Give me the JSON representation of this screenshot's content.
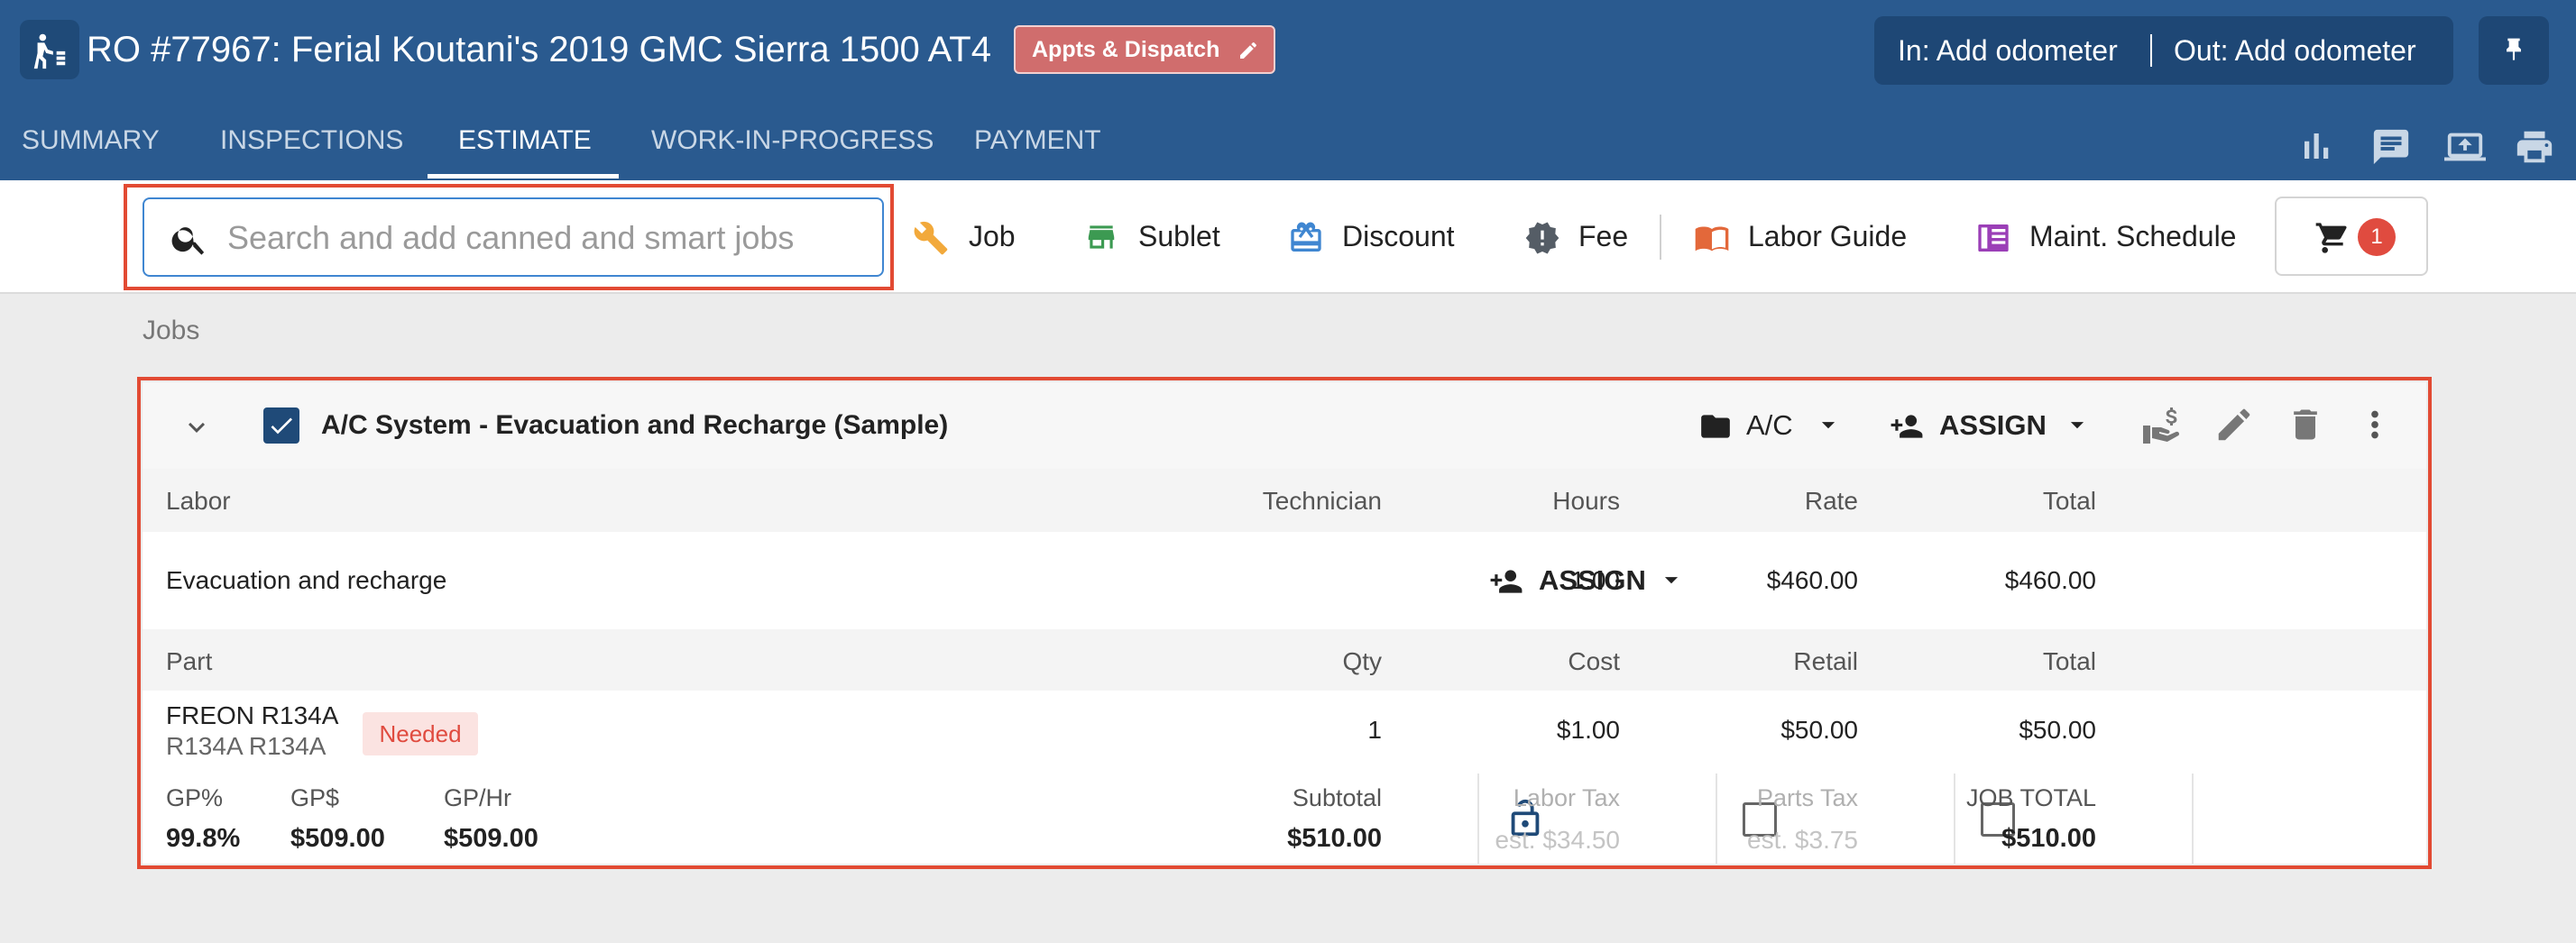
{
  "header": {
    "title": "RO #77967: Ferial Koutani's 2019 GMC Sierra 1500 AT4",
    "appts_label": "Appts & Dispatch",
    "odometer_in": "In: Add odometer",
    "odometer_out": "Out: Add odometer"
  },
  "tabs": [
    {
      "label": "SUMMARY",
      "active": false
    },
    {
      "label": "INSPECTIONS",
      "active": false
    },
    {
      "label": "ESTIMATE",
      "active": true
    },
    {
      "label": "WORK-IN-PROGRESS",
      "active": false
    },
    {
      "label": "PAYMENT",
      "active": false
    }
  ],
  "toolbar": {
    "search_placeholder": "Search and add canned and smart jobs",
    "job": "Job",
    "sublet": "Sublet",
    "discount": "Discount",
    "fee": "Fee",
    "labor_guide": "Labor Guide",
    "maint_schedule": "Maint. Schedule",
    "cart_count": "1"
  },
  "jobs_label": "Jobs",
  "job": {
    "title": "A/C System - Evacuation and Recharge (Sample)",
    "category": "A/C",
    "assign_label": "ASSIGN",
    "labor_headers": {
      "labor": "Labor",
      "technician": "Technician",
      "hours": "Hours",
      "rate": "Rate",
      "total": "Total"
    },
    "labor_rows": [
      {
        "name": "Evacuation and recharge",
        "technician": "ASSIGN",
        "hours": "1.00",
        "rate": "$460.00",
        "total": "$460.00"
      }
    ],
    "part_headers": {
      "part": "Part",
      "qty": "Qty",
      "cost": "Cost",
      "retail": "Retail",
      "total": "Total"
    },
    "part_rows": [
      {
        "name": "FREON R134A",
        "number": "R134A R134A",
        "status": "Needed",
        "qty": "1",
        "cost": "$1.00",
        "retail": "$50.00",
        "total": "$50.00"
      }
    ],
    "footer": {
      "gp_pct_label": "GP%",
      "gp_pct": "99.8%",
      "gp_dollar_label": "GP$",
      "gp_dollar": "$509.00",
      "gp_hr_label": "GP/Hr",
      "gp_hr": "$509.00",
      "subtotal_label": "Subtotal",
      "subtotal": "$510.00",
      "labor_tax_label": "Labor Tax",
      "labor_tax": "est. $34.50",
      "parts_tax_label": "Parts Tax",
      "parts_tax": "est. $3.75",
      "job_total_label": "JOB TOTAL",
      "job_total": "$510.00"
    }
  },
  "colors": {
    "header_bg": "#2a5a8f",
    "accent_red": "#e24a33",
    "appts_bg": "#d06d6d",
    "check_blue": "#1f4a78"
  }
}
